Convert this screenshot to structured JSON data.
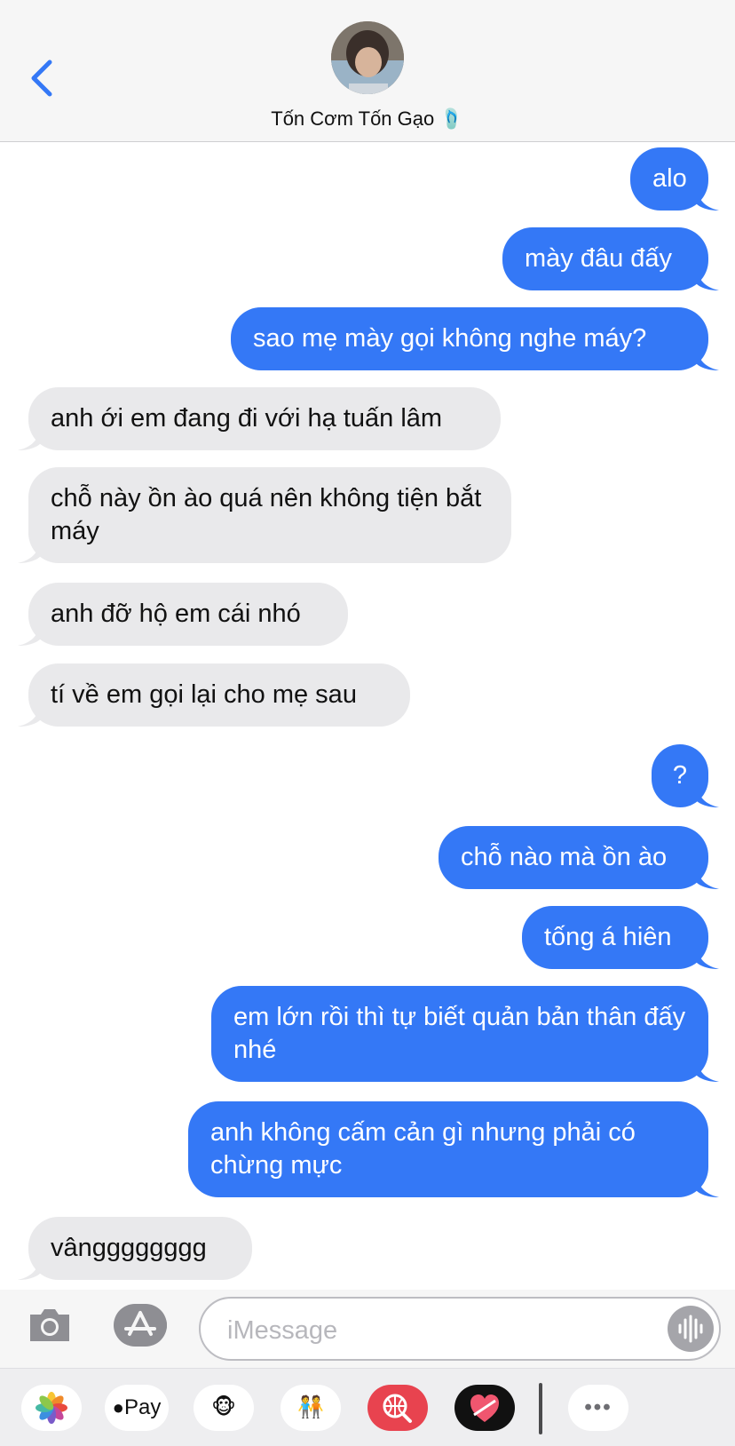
{
  "contact": {
    "name": "Tốn Cơm Tốn Gạo 🩴"
  },
  "messages": [
    {
      "dir": "out",
      "text": "alo"
    },
    {
      "dir": "out",
      "text": "mày đâu đấy"
    },
    {
      "dir": "out",
      "text": "sao mẹ mày gọi không nghe máy?"
    },
    {
      "dir": "in",
      "text": "anh ới em đang đi với hạ tuấn lâm"
    },
    {
      "dir": "in",
      "text": "chỗ này ồn ào quá nên không tiện bắt máy"
    },
    {
      "dir": "in",
      "text": "anh đỡ hộ em cái nhó"
    },
    {
      "dir": "in",
      "text": "tí về em gọi lại cho mẹ sau"
    },
    {
      "dir": "out",
      "text": "?"
    },
    {
      "dir": "out",
      "text": "chỗ nào mà ồn ào"
    },
    {
      "dir": "out",
      "text": "tống á hiên"
    },
    {
      "dir": "out",
      "text": "em lớn rồi thì tự biết quản bản thân đấy nhé"
    },
    {
      "dir": "out",
      "text": "anh không cấm cản gì nhưng phải có chừng mực"
    },
    {
      "dir": "in",
      "text": "vângggggggg"
    }
  ],
  "compose": {
    "placeholder": "iMessage"
  },
  "apps": {
    "photos": "photos-icon",
    "applepay": "Pay",
    "animoji": "🐵",
    "memoji": "🧑‍🤝‍🧑",
    "search": "search-globe-icon",
    "digitaltouch": "heart-icon",
    "more": "•••"
  },
  "colors": {
    "outgoing": "#3478f6",
    "incoming": "#e9e9eb",
    "accent": "#3478f6"
  }
}
